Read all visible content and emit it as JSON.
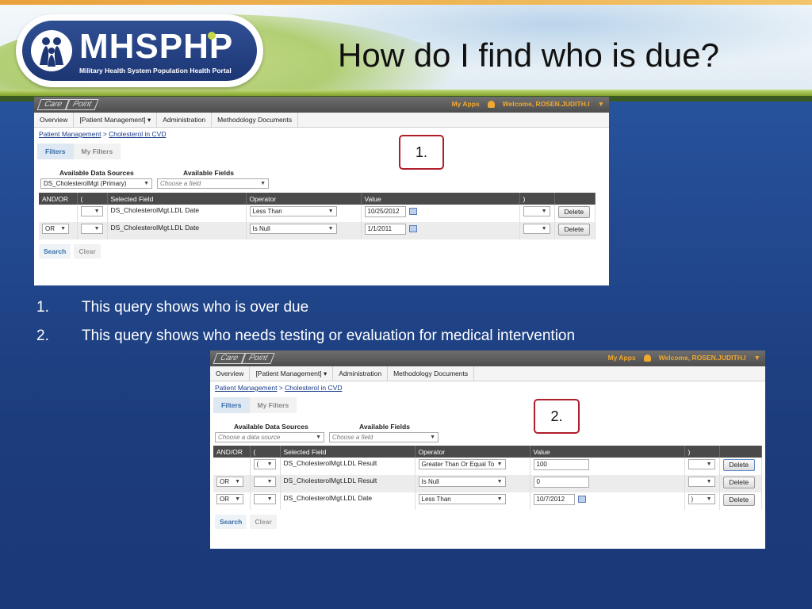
{
  "slide": {
    "title": "How do I find who is due?",
    "logo": {
      "name": "MHSPHP",
      "subtitle": "Military Health System Population Health Portal"
    },
    "list": [
      {
        "num": "1.",
        "text": "This query shows who is over due"
      },
      {
        "num": "2.",
        "text": "This query shows who needs testing or evaluation for medical intervention"
      }
    ]
  },
  "shot1": {
    "callout": "1.",
    "brand": [
      "Care",
      "Point"
    ],
    "my_apps": "My Apps",
    "welcome": "Welcome, ROSEN.JUDITH.I",
    "nav": [
      "Overview",
      "[Patient Management] ▾",
      "Administration",
      "Methodology Documents"
    ],
    "crumb_a": "Patient Management",
    "crumb_sep": ">",
    "crumb_b": "Cholesterol in CVD",
    "tab_filters": "Filters",
    "tab_my_filters": "My Filters",
    "label_sources": "Available Data Sources",
    "label_fields": "Available Fields",
    "source_value": "DS_CholesterolMgt (Primary)",
    "field_placeholder": "Choose a field",
    "headers": [
      "AND/OR",
      "(",
      "Selected Field",
      "Operator",
      "Value",
      ")",
      ""
    ],
    "rows": [
      {
        "andor": "",
        "field": "DS_CholesterolMgt.LDL Date",
        "operator": "Less Than",
        "value": "10/25/2012",
        "delete": "Delete"
      },
      {
        "andor": "OR",
        "field": "DS_CholesterolMgt.LDL Date",
        "operator": "Is Null",
        "value": "1/1/2011",
        "delete": "Delete"
      }
    ],
    "search": "Search",
    "clear": "Clear"
  },
  "shot2": {
    "callout": "2.",
    "brand": [
      "Care",
      "Point"
    ],
    "my_apps": "My Apps",
    "welcome": "Welcome, ROSEN.JUDITH.I",
    "nav": [
      "Overview",
      "[Patient Management] ▾",
      "Administration",
      "Methodology Documents"
    ],
    "crumb_a": "Patient Management",
    "crumb_sep": ">",
    "crumb_b": "Cholesterol in CVD",
    "tab_filters": "Filters",
    "tab_my_filters": "My Filters",
    "label_sources": "Available Data Sources",
    "label_fields": "Available Fields",
    "source_placeholder": "Choose a data source",
    "field_placeholder": "Choose a field",
    "headers": [
      "AND/OR",
      "(",
      "Selected Field",
      "Operator",
      "Value",
      ")",
      ""
    ],
    "rows": [
      {
        "andor": "",
        "paren": "(",
        "field": "DS_CholesterolMgt.LDL Result",
        "operator": "Greater Than Or Equal To",
        "value": "100",
        "close": "",
        "delete": "Delete"
      },
      {
        "andor": "OR",
        "paren": "",
        "field": "DS_CholesterolMgt.LDL Result",
        "operator": "Is Null",
        "value": "0",
        "close": "",
        "delete": "Delete"
      },
      {
        "andor": "OR",
        "paren": "",
        "field": "DS_CholesterolMgt.LDL Date",
        "operator": "Less Than",
        "value": "10/7/2012",
        "close": ")",
        "delete": "Delete"
      }
    ],
    "search": "Search",
    "clear": "Clear"
  }
}
